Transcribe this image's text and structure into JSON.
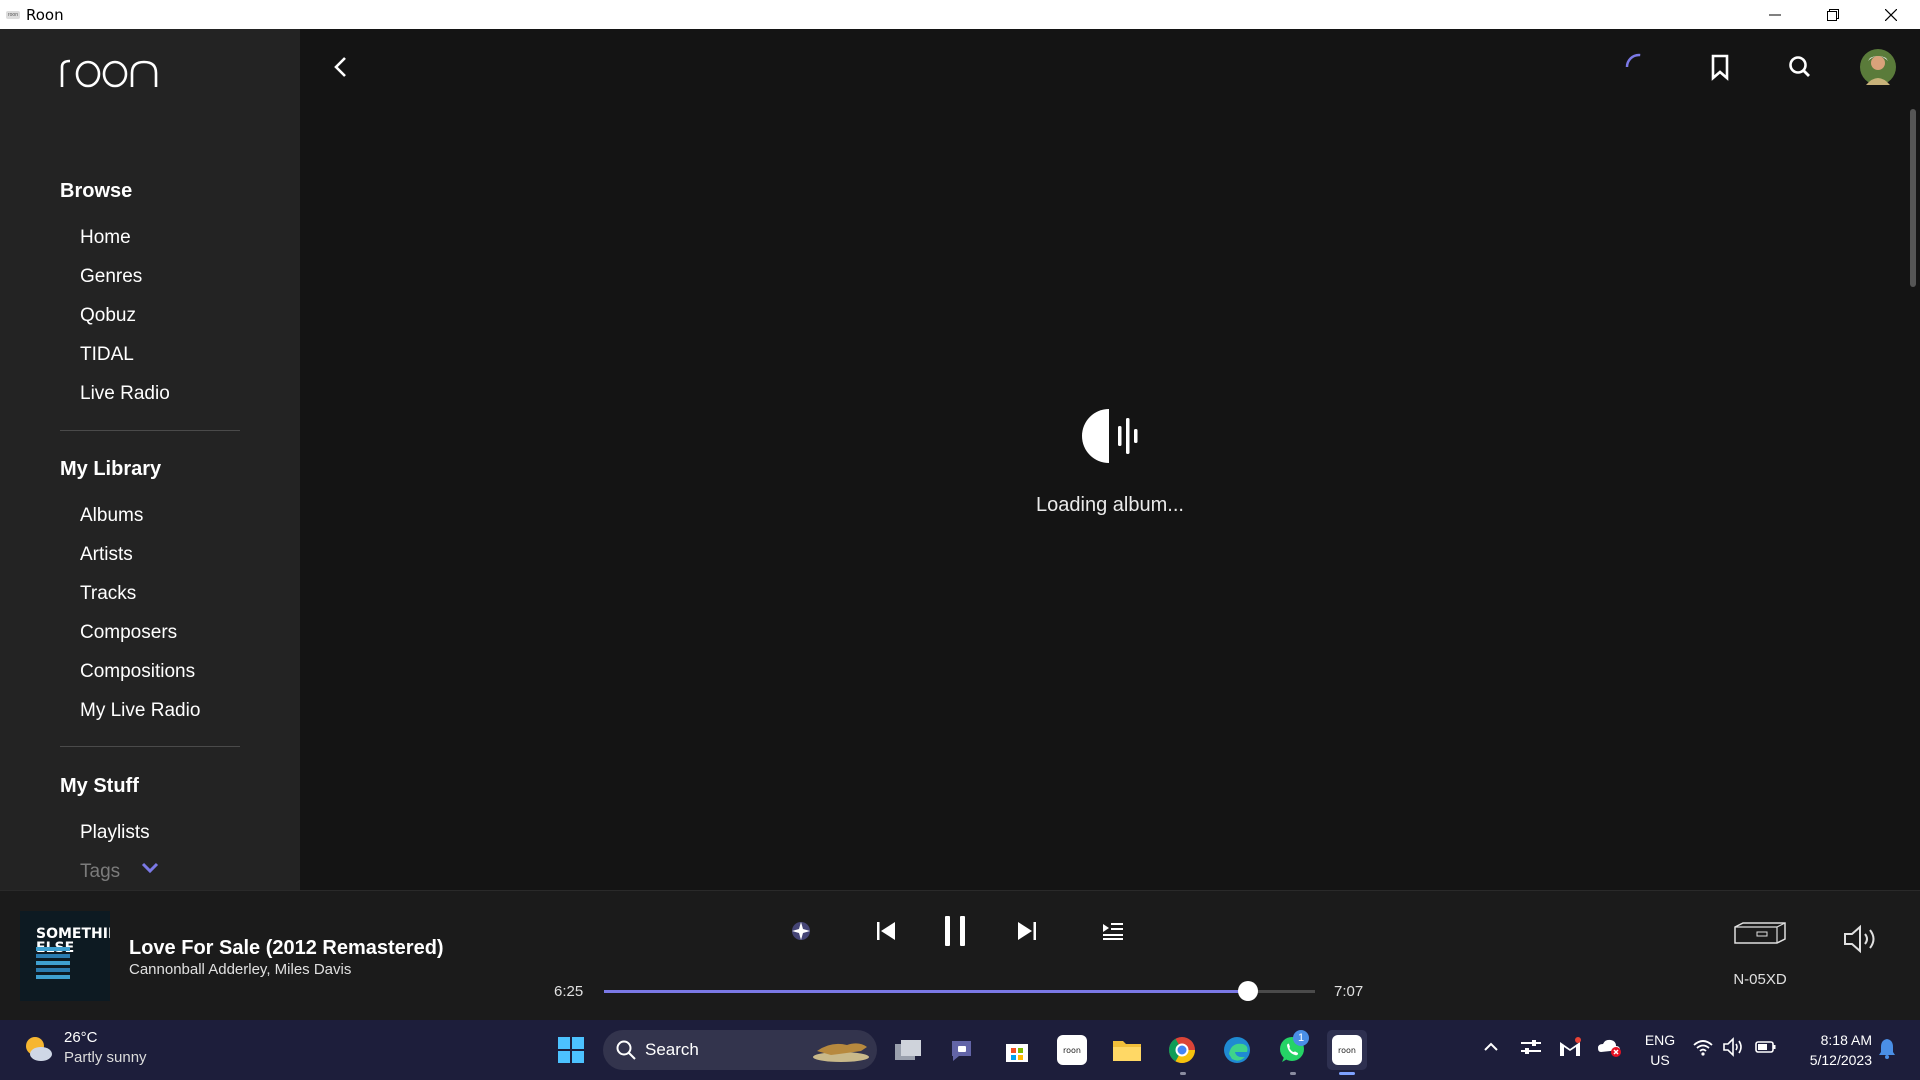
{
  "window": {
    "title": "Roon"
  },
  "sidebar": {
    "logo_text": "roon",
    "browse": {
      "heading": "Browse",
      "items": [
        "Home",
        "Genres",
        "Qobuz",
        "TIDAL",
        "Live Radio"
      ]
    },
    "library": {
      "heading": "My Library",
      "items": [
        "Albums",
        "Artists",
        "Tracks",
        "Composers",
        "Compositions",
        "My Live Radio"
      ]
    },
    "stuff": {
      "heading": "My Stuff",
      "items": [
        "Playlists",
        "Tags"
      ]
    }
  },
  "main": {
    "loading_text": "Loading album..."
  },
  "player": {
    "track_title": "Love For Sale (2012 Remastered)",
    "track_artist": "Cannonball Adderley, Miles Davis",
    "album_art_text": "SOMETHIN' ELSE",
    "elapsed": "6:25",
    "duration": "7:07",
    "progress_fraction": 0.906,
    "zone_name": "N-05XD",
    "accent_color": "#7b79e6"
  },
  "taskbar": {
    "weather_temp": "26°C",
    "weather_cond": "Partly sunny",
    "search_label": "Search",
    "whatsapp_badge": "1",
    "lang_line1": "ENG",
    "lang_line2": "US",
    "time": "8:18 AM",
    "date": "5/12/2023"
  }
}
